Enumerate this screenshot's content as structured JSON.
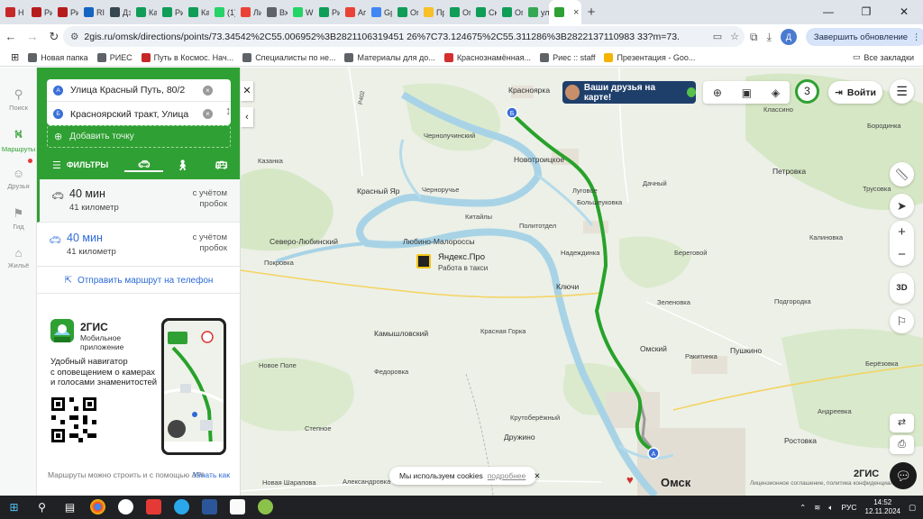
{
  "browser": {
    "tabs": [
      {
        "label": "Н",
        "color": "#c62828"
      },
      {
        "label": "Ри",
        "color": "#b71c1c"
      },
      {
        "label": "Ри",
        "color": "#b71c1c"
      },
      {
        "label": "RI",
        "color": "#1565c0"
      },
      {
        "label": "Дз",
        "color": "#37474f"
      },
      {
        "label": "Ка",
        "color": "#0f9d58"
      },
      {
        "label": "Ри",
        "color": "#0f9d58"
      },
      {
        "label": "Ка",
        "color": "#0f9d58"
      },
      {
        "label": "(1)",
        "color": "#25d366"
      },
      {
        "label": "Ли",
        "color": "#ea4335"
      },
      {
        "label": "Вх",
        "color": "#5f6368"
      },
      {
        "label": "Wi",
        "color": "#25d366"
      },
      {
        "label": "Ри",
        "color": "#0f9d58"
      },
      {
        "label": "Аг",
        "color": "#ea4335"
      },
      {
        "label": "Gр",
        "color": "#4285f4"
      },
      {
        "label": "Ог",
        "color": "#0f9d58"
      },
      {
        "label": "Пр",
        "color": "#f6c026"
      },
      {
        "label": "Ог",
        "color": "#0f9d58"
      },
      {
        "label": "Ск",
        "color": "#0f9d58"
      },
      {
        "label": "Ог",
        "color": "#0f9d58"
      },
      {
        "label": "ул",
        "color": "#34a853"
      },
      {
        "label": "",
        "color": "#2fa033"
      }
    ],
    "new_tab": "+",
    "window_controls": {
      "minimize": "—",
      "maximize": "❐",
      "close": "✕"
    },
    "url": "2gis.ru/omsk/directions/points/73.34542%2C55.006952%3B2821106319451 26%7C73.124675%2C55.311286%3B2822137110983 33?m=73.233693%2C55.159946%2F10.61",
    "profile_initial": "Д",
    "update_button": "Завершить обновление",
    "bookmarks": [
      {
        "label": "Новая папка",
        "color": "#5f6368"
      },
      {
        "label": "РИЕС",
        "color": "#5f6368"
      },
      {
        "label": "Путь в Космос. Нач...",
        "color": "#c62828"
      },
      {
        "label": "Специалисты по не...",
        "color": "#5f6368"
      },
      {
        "label": "Материалы для до...",
        "color": "#5f6368"
      },
      {
        "label": "Краснознамённая...",
        "color": "#d32f2f"
      },
      {
        "label": "Риес :: staff",
        "color": "#5f6368"
      },
      {
        "label": "Презентация - Goo...",
        "color": "#f4b400"
      }
    ],
    "all_bookmarks": "Все закладки"
  },
  "sidenav": {
    "items": [
      {
        "label": "Поиск",
        "icon": "search-icon"
      },
      {
        "label": "Маршруты",
        "icon": "routes-icon"
      },
      {
        "label": "Друзья",
        "icon": "friends-icon"
      },
      {
        "label": "Гид",
        "icon": "guide-icon"
      },
      {
        "label": "Жильё",
        "icon": "housing-icon"
      }
    ]
  },
  "route": {
    "from": {
      "marker": "A",
      "value": "Улица Красный Путь, 80/2"
    },
    "to": {
      "marker": "Б",
      "value": "Красноярский тракт, Улица"
    },
    "add_point": "Добавить точку",
    "filters": "ФИЛЬТРЫ",
    "results": [
      {
        "time": "40 мин",
        "distance": "41 километр",
        "note_line1": "с учётом",
        "note_line2": "пробок"
      },
      {
        "time": "40 мин",
        "distance": "41 километр",
        "note_line1": "с учётом",
        "note_line2": "пробок"
      }
    ],
    "send_to_phone": "Отправить маршрут на телефон"
  },
  "promo": {
    "brand": "2ГИС",
    "subtitle_line1": "Мобильное",
    "subtitle_line2": "приложение",
    "title_line1": "Удобный навигатор",
    "title_line2": "с оповещением о камерах",
    "title_line3": "и голосами знаменитостей"
  },
  "footer": {
    "text": "Маршруты можно строить и с помощью API",
    "link": "Узнать как"
  },
  "map": {
    "friends_banner": "Ваши друзья на карте!",
    "badge_count": "3",
    "login": "Войти",
    "btn_3d": "3D",
    "poi_name": "Яндекс.Про",
    "poi_sub": "Работа в такси",
    "cookie_text": "Мы используем cookies",
    "cookie_more": "подробнее",
    "brand": "2ГИС",
    "copyright": "Лицензионное соглашение, политика конфиденциальности",
    "labels": {
      "krasnoyarka": "Красноярка",
      "klassino": "Классино",
      "borodinka": "Бородинка",
      "chernoluchinsky": "Чернолучинский",
      "novotroitskoe": "Новотроицкое",
      "kazanka": "Казанка",
      "krasny_yar": "Красный Яр",
      "chernoluchie": "Черноручье",
      "lugovoe": "Луговое",
      "dachny": "Дачный",
      "petrovka": "Петровка",
      "trusovka": "Трусовка",
      "kitayly": "Китайлы",
      "bolsheukovo": "Большеуковка",
      "politotdel": "Политотдел",
      "severo_lyubinsky": "Северо-Любинский",
      "lyubino": "Любино-Малороссы",
      "nadezhdinka": "Надеждинка",
      "beregovoy": "Береговой",
      "kalinovka": "Калиновка",
      "pokrovka": "Покровка",
      "klyuchi": "Ключи",
      "zelenovka": "Зеленовка",
      "podgorodka": "Подгородка",
      "krasnaya_gorka": "Красная Горка",
      "kamyshlovsky": "Камышловский",
      "omsky": "Омский",
      "pushkino": "Пушкино",
      "rakitinka": "Ракитинка",
      "berezovka": "Берёзовка",
      "fedorovka": "Федоровка",
      "novoe_pole": "Новое Поле",
      "krutoberezhny": "Крутоберёжный",
      "stepnoe": "Степное",
      "druzhino": "Дружино",
      "andreevka": "Андреевка",
      "rostovka": "Ростовка",
      "alexandrovka": "Александровка",
      "novaya_sharapovka": "Новая Шарапова",
      "omsk": "Омск",
      "road_r402": "Р402"
    }
  },
  "taskbar": {
    "lang": "РУС",
    "time": "14:52",
    "date": "12.11.2024"
  },
  "colors": {
    "accent_green": "#2fa033",
    "route_green": "#27a22a",
    "link_blue": "#2e6ad6"
  }
}
